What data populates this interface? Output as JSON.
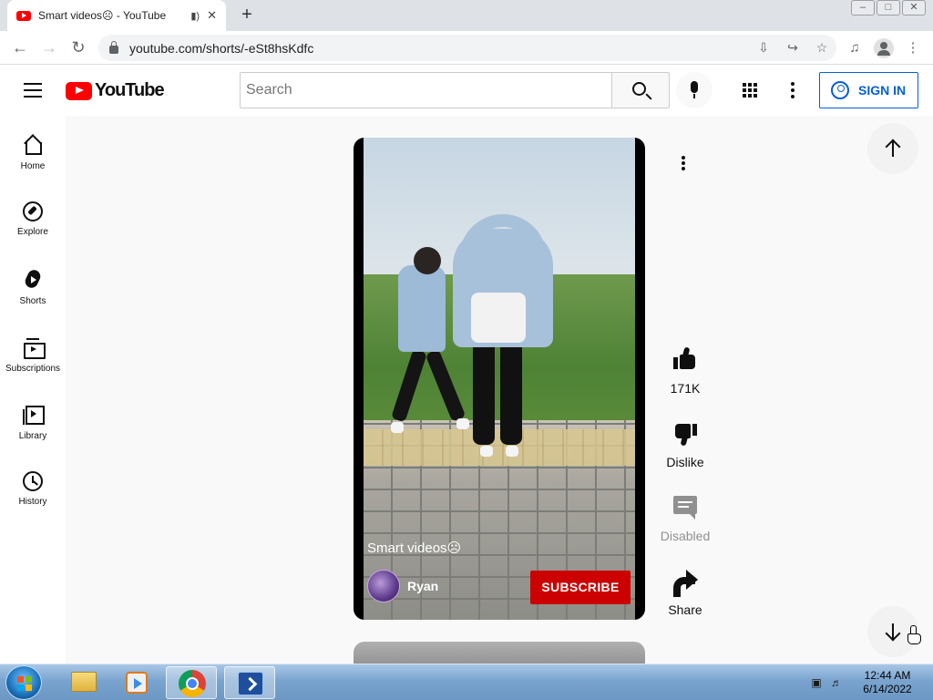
{
  "browser": {
    "tab": {
      "title": "Smart videos☹ - YouTube",
      "audio_icon": "speaker-icon",
      "close_label": "✕"
    },
    "new_tab_label": "+",
    "window_controls": {
      "minimize": "–",
      "restore": "□",
      "close": "✕"
    },
    "nav": {
      "back": "←",
      "forward": "→",
      "reload": "↻"
    },
    "url": "youtube.com/shorts/-eSt8hsKdfc",
    "omnibox_icons": {
      "install": "⇩",
      "share": "↪",
      "bookmark": "☆"
    },
    "toolbar_icons": {
      "media": "♫",
      "menu": "⋮"
    }
  },
  "masthead": {
    "logo_text": "YouTube",
    "search_placeholder": "Search",
    "signin_label": "SIGN IN"
  },
  "guide": {
    "items": [
      {
        "label": "Home",
        "icon": "home-icon"
      },
      {
        "label": "Explore",
        "icon": "compass-icon"
      },
      {
        "label": "Shorts",
        "icon": "shorts-icon"
      },
      {
        "label": "Subscriptions",
        "icon": "subscriptions-icon"
      },
      {
        "label": "Library",
        "icon": "library-icon"
      },
      {
        "label": "History",
        "icon": "history-icon"
      }
    ]
  },
  "short": {
    "title": "Smart videos☹",
    "channel": "Ryan",
    "subscribe_label": "SUBSCRIBE",
    "subscribe_color": "#cc0000"
  },
  "actions": {
    "like_count": "171K",
    "dislike_label": "Dislike",
    "comments_label": "Disabled",
    "share_label": "Share"
  },
  "taskbar": {
    "time": "12:44 AM",
    "date": "6/14/2022"
  },
  "colors": {
    "youtube_red": "#ff0000",
    "link_blue": "#065fd4"
  }
}
